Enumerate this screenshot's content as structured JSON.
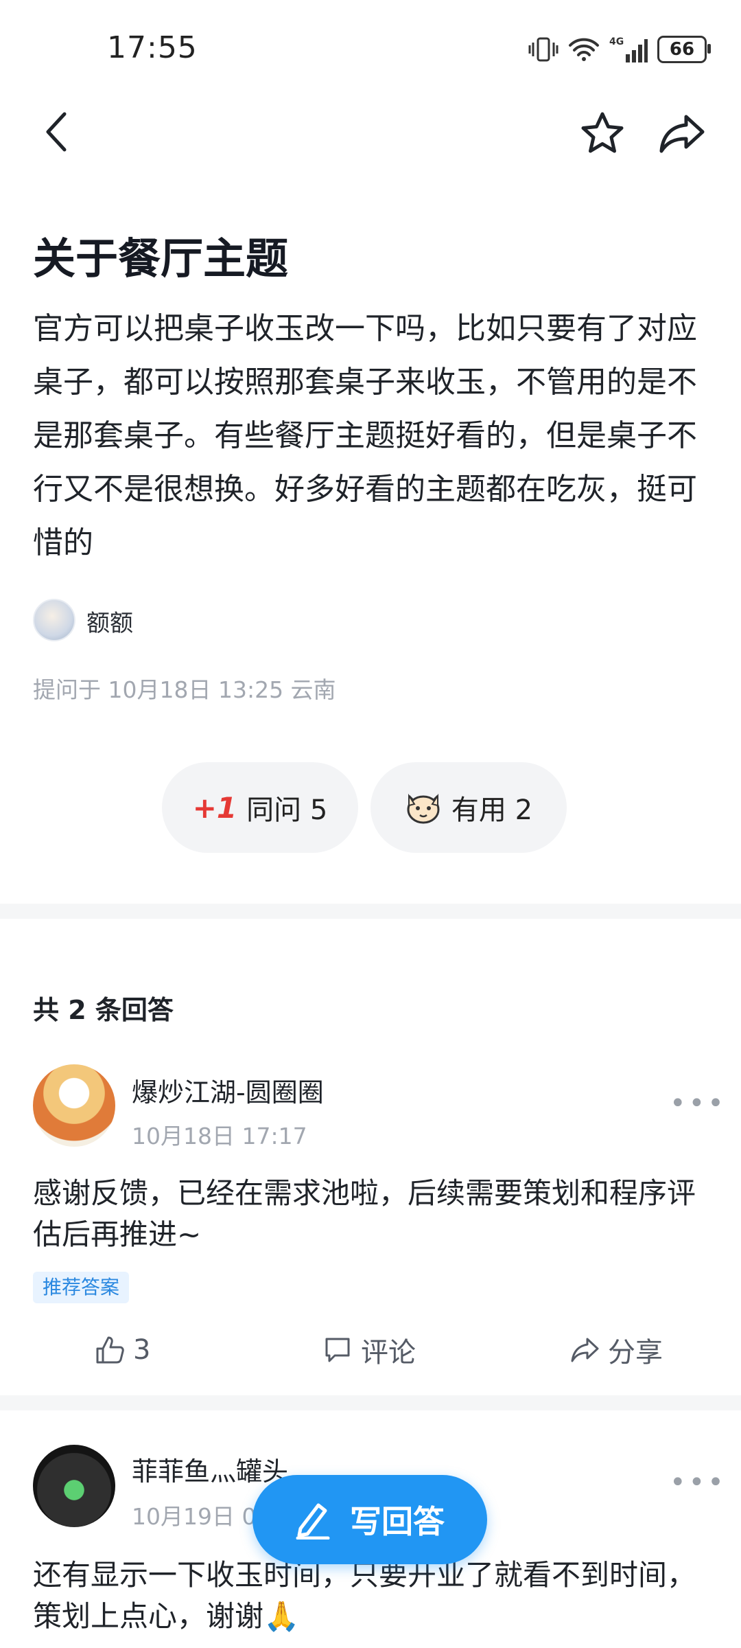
{
  "status_bar": {
    "time": "17:55",
    "battery": "66"
  },
  "question": {
    "title": "关于餐厅主题",
    "body": "官方可以把桌子收玉改一下吗，比如只要有了对应桌子，都可以按照那套桌子来收玉，不管用的是不是那套桌子。有些餐厅主题挺好看的，但是桌子不行又不是很想换。好多好看的主题都在吃灰，挺可惜的",
    "author": "额额",
    "meta": "提问于 10月18日 13:25 云南"
  },
  "reactions": [
    {
      "label": "同问 5",
      "prefix": "+1"
    },
    {
      "label": "有用 2"
    }
  ],
  "answers_header": "共 2 条回答",
  "answers": [
    {
      "name": "爆炒江湖-圆圈圈",
      "date": "10月18日 17:17",
      "text": "感谢反馈，已经在需求池啦，后续需要策划和程序评估后再推进~",
      "tag": "推荐答案",
      "likes": "3",
      "comment_label": "评论",
      "share_label": "分享"
    },
    {
      "name": "菲菲鱼灬罐头",
      "date": "10月19日 0",
      "text": "还有显示一下收玉时间，只要开业了就看不到时间，策划上点心，谢谢🙏"
    }
  ],
  "fab_label": "写回答",
  "colors": {
    "accent": "#2196f3",
    "tag_bg": "#e8f3ff",
    "tag_text": "#2a88e0"
  }
}
